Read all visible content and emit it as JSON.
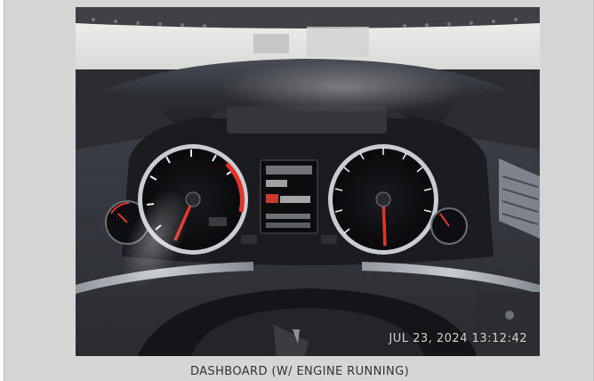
{
  "photo": {
    "timestamp": "JUL 23, 2024 13:12:42",
    "dashboard": {
      "left_gauge": "tachometer",
      "right_gauge": "speedometer",
      "left_small_gauge": "coolant-temperature",
      "right_small_gauge": "fuel-level",
      "center_display": "driver-information-display"
    }
  },
  "caption": "DASHBOARD (W/ ENGINE RUNNING)",
  "colors": {
    "frame_bg": "#d5d5d5",
    "dash_dark": "#1b1c20",
    "gauge_face": "#0f1013",
    "gauge_ring": "#c9ccd2",
    "needle": "#e0342a",
    "sky_glare": "#f1f2ef"
  }
}
